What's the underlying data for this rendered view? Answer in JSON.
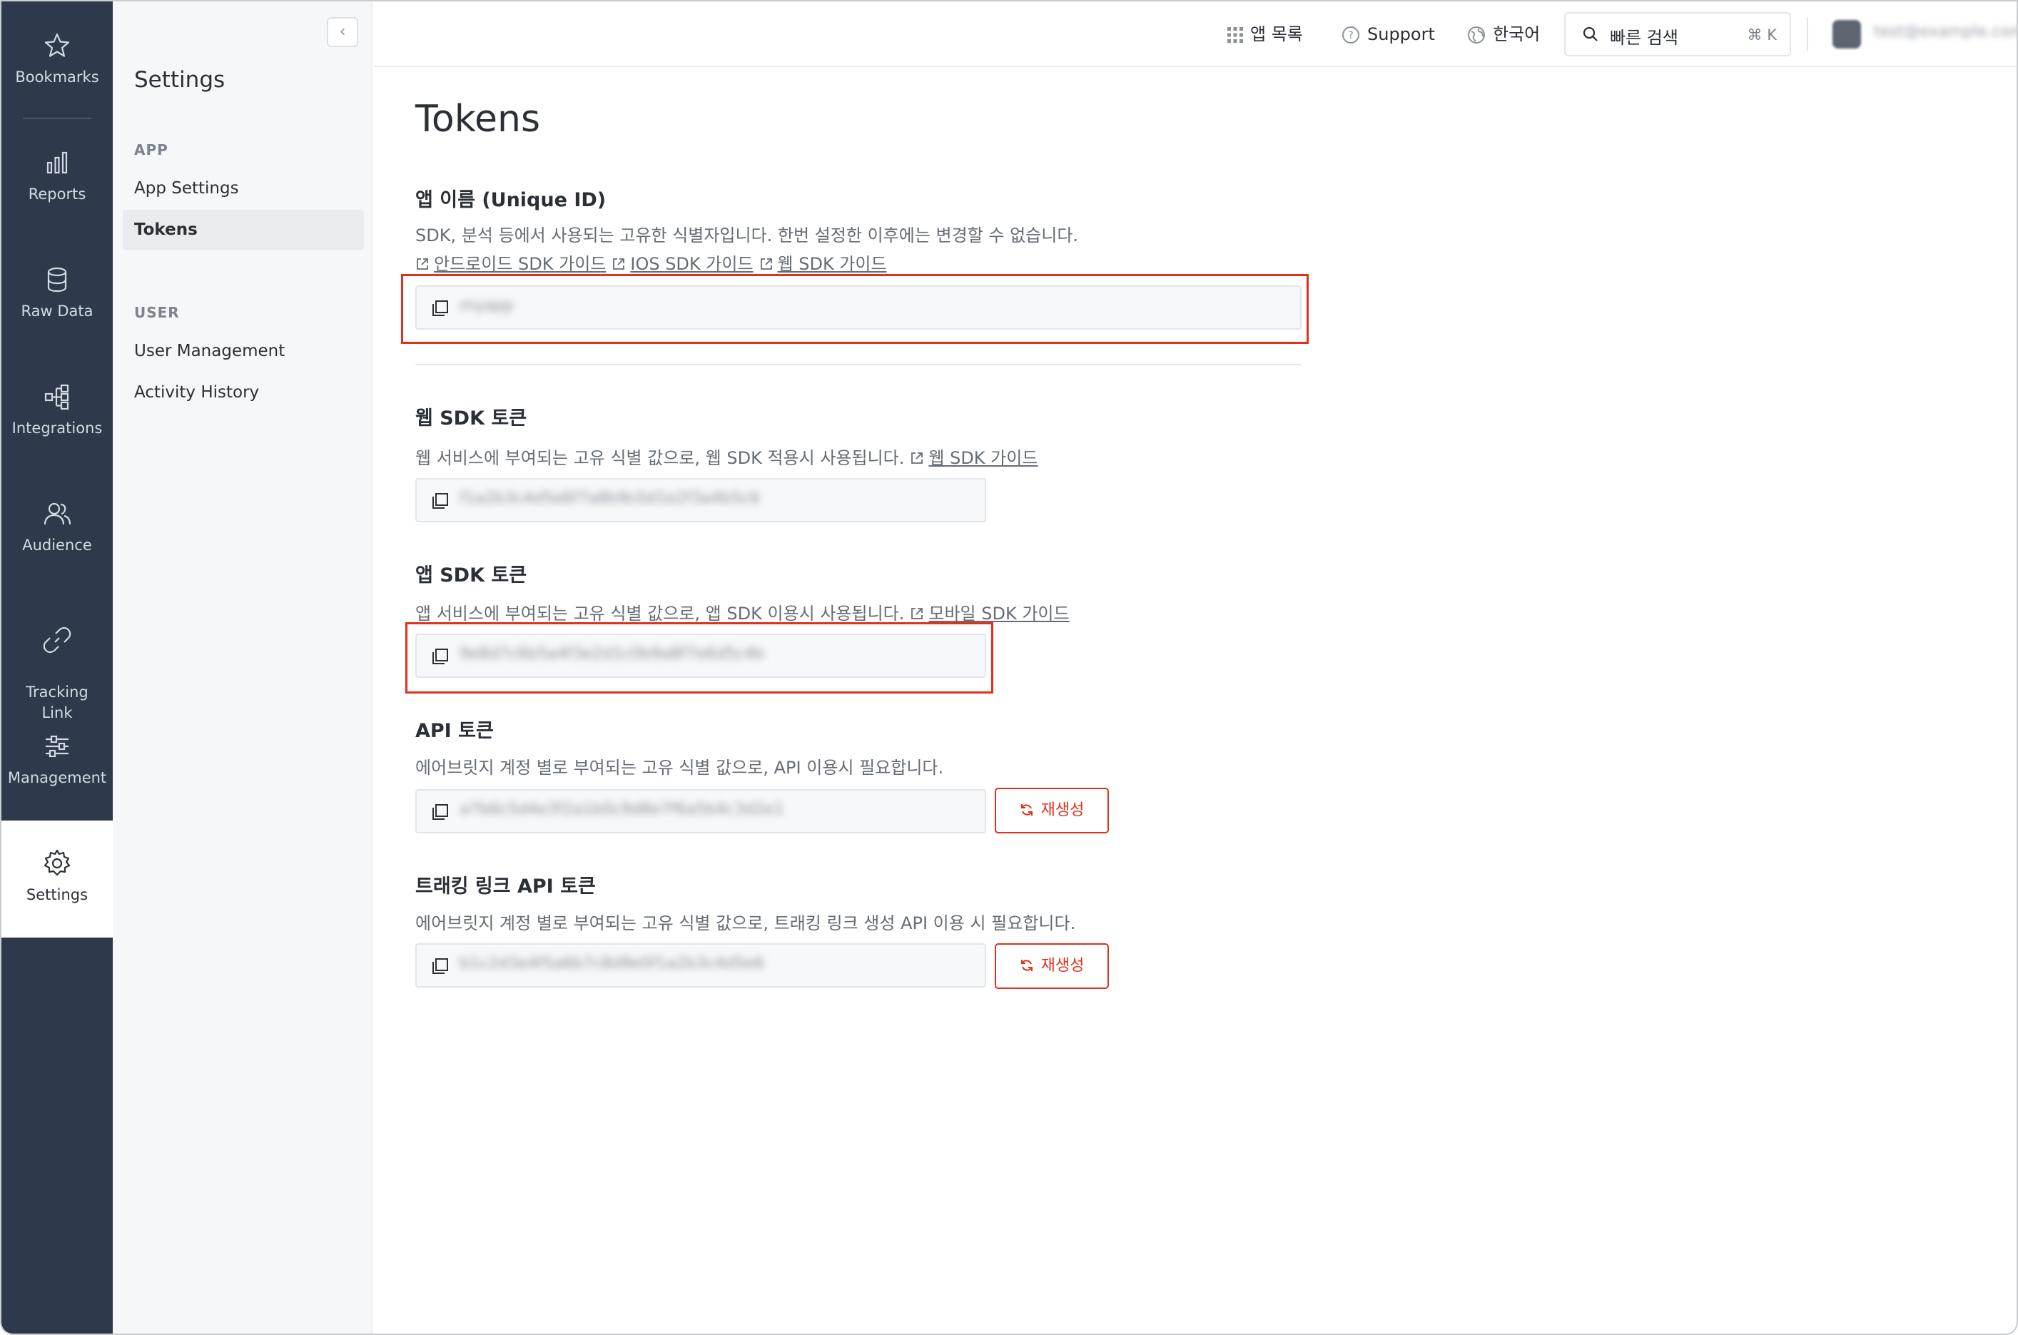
{
  "nav": {
    "items": [
      {
        "label": "Bookmarks",
        "icon": "star-icon"
      },
      {
        "label": "Reports",
        "icon": "bar-chart-icon"
      },
      {
        "label": "Raw Data",
        "icon": "database-icon"
      },
      {
        "label": "Integrations",
        "icon": "integrations-icon"
      },
      {
        "label": "Audience",
        "icon": "users-icon"
      },
      {
        "label": "Tracking\nLink",
        "icon": "link-icon"
      },
      {
        "label": "Management",
        "icon": "sliders-icon"
      },
      {
        "label": "Settings",
        "icon": "gear-icon",
        "active": true
      }
    ]
  },
  "subnav": {
    "title": "Settings",
    "groups": [
      {
        "name": "APP",
        "links": [
          "App Settings",
          "Tokens"
        ]
      },
      {
        "name": "USER",
        "links": [
          "User Management",
          "Activity History"
        ]
      }
    ],
    "active": "Tokens"
  },
  "topbar": {
    "apps": "앱 목록",
    "support": "Support",
    "language": "한국어",
    "search_label": "빠른 검색",
    "search_shortcut": "⌘ K",
    "user_email": "test@example.com"
  },
  "main": {
    "title": "Tokens",
    "app_name": {
      "title": "앱 이름 (Unique ID)",
      "desc": "SDK, 분석 등에서 사용되는 고유한 식별자입니다. 한번 설정한 이후에는 변경할 수 없습니다.",
      "links": [
        "안드로이드 SDK 가이드",
        "IOS SDK 가이드",
        "웹 SDK 가이드"
      ],
      "value": "myapp"
    },
    "web_sdk": {
      "title": "웹 SDK 토큰",
      "desc": "웹 서비스에 부여되는 고유 식별 값으로, 웹 SDK 적용시 사용됩니다.",
      "link": "웹 SDK 가이드",
      "value": "f1a2b3c4d5e6f7a8b9c0d1e2f3a4b5c6"
    },
    "app_sdk": {
      "title": "앱 SDK 토큰",
      "desc": "앱 서비스에 부여되는 고유 식별 값으로, 앱 SDK 이용시 사용됩니다.",
      "link": "모바일 SDK 가이드",
      "value": "9e8d7c6b5a4f3e2d1c0b9a8f7e6d5c4b"
    },
    "api": {
      "title": "API 토큰",
      "desc": "에어브릿지 계정 별로 부여되는 고유 식별 값으로, API 이용시 필요합니다.",
      "value": "a7b6c5d4e3f2a1b0c9d8e7f6a5b4c3d2e1",
      "regen": "재생성"
    },
    "tracking_api": {
      "title": "트래킹 링크 API 토큰",
      "desc": "에어브릿지 계정 별로 부여되는 고유 식별 값으로, 트래킹 링크 생성 API 이용 시 필요합니다.",
      "value": "b1c2d3e4f5a6b7c8d9e0f1a2b3c4d5e6",
      "regen": "재생성"
    }
  },
  "colors": {
    "nav_bg": "#2e3a4b",
    "highlight": "#e0311f",
    "accent_red": "#e0311f"
  }
}
